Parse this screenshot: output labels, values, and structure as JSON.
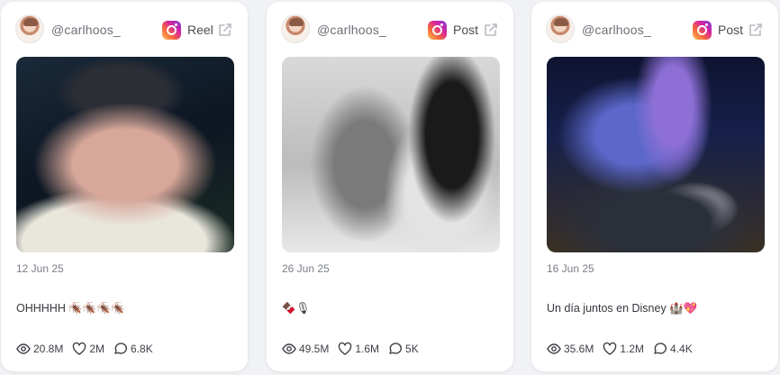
{
  "posts": [
    {
      "username": "@carlhoos_",
      "platform_icon": "instagram-icon",
      "type": "Reel",
      "date": "12 Jun 25",
      "caption": "OHHHHH 🪳🪳🪳🪳",
      "views": "20.8M",
      "likes": "2M",
      "comments": "6.8K"
    },
    {
      "username": "@carlhoos_",
      "platform_icon": "instagram-icon",
      "type": "Post",
      "date": "26 Jun 25",
      "caption": "🍫🎙",
      "views": "49.5M",
      "likes": "1.6M",
      "comments": "5K"
    },
    {
      "username": "@carlhoos_",
      "platform_icon": "instagram-icon",
      "type": "Post",
      "date": "16 Jun 25",
      "caption": "Un día juntos en Disney 🏰💖",
      "views": "35.6M",
      "likes": "1.2M",
      "comments": "4.4K"
    }
  ],
  "colors": {
    "background": "#f1f2f5",
    "card": "#ffffff",
    "muted_text": "#7b7f86",
    "body_text": "#34373c"
  }
}
